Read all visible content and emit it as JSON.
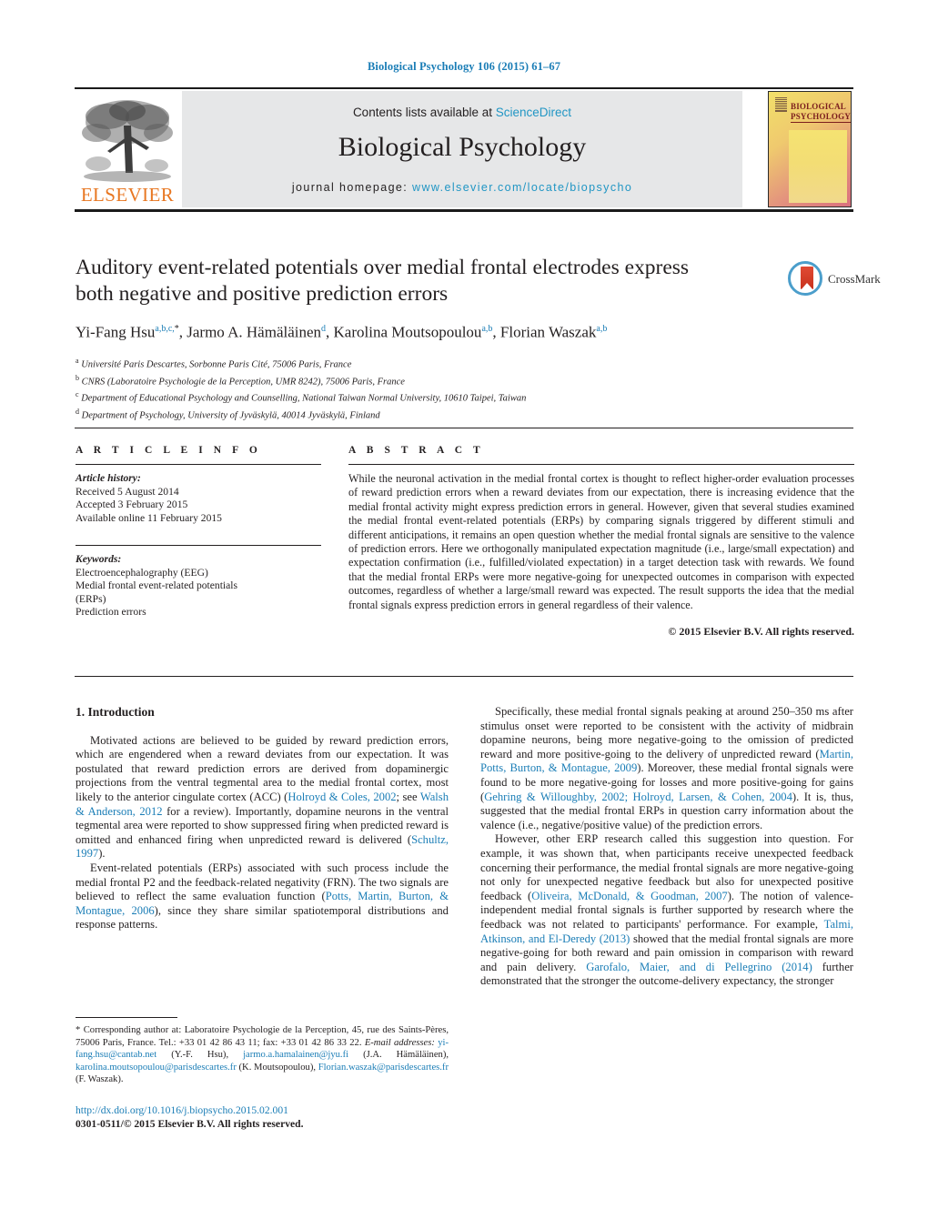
{
  "running_head": "Biological Psychology 106 (2015) 61–67",
  "masthead": {
    "contents_prefix": "Contents lists available at ",
    "sciencedirect": "ScienceDirect",
    "journal_title": "Biological Psychology",
    "homepage_prefix": "journal homepage: ",
    "homepage_url": "www.elsevier.com/locate/biopsycho",
    "publisher_logo_text": "ELSEVIER",
    "cover_title_line1": "BIOLOGICAL",
    "cover_title_line2": "PSYCHOLOGY",
    "link_color": "#2196c4",
    "header_color": "#1a7db6"
  },
  "crossmark": {
    "label": "CrossMark"
  },
  "article": {
    "title": "Auditory event-related potentials over medial frontal electrodes express both negative and positive prediction errors",
    "authors_html": "Yi-Fang Hsu<sup>a,b,c,</sup><sup class=\"star\">*</sup>, Jarmo A. Hämäläinen<sup>d</sup>, Karolina Moutsopoulou<sup>a,b</sup>, Florian Waszak<sup>a,b</sup>",
    "affiliations": [
      {
        "mark": "a",
        "text": "Université Paris Descartes, Sorbonne Paris Cité, 75006 Paris, France"
      },
      {
        "mark": "b",
        "text": "CNRS (Laboratoire Psychologie de la Perception, UMR 8242), 75006 Paris, France"
      },
      {
        "mark": "c",
        "text": "Department of Educational Psychology and Counselling, National Taiwan Normal University, 10610 Taipei, Taiwan"
      },
      {
        "mark": "d",
        "text": "Department of Psychology, University of Jyväskylä, 40014 Jyväskylä, Finland"
      }
    ]
  },
  "article_info": {
    "heading": "A R T I C L E    I N F O",
    "history_label": "Article history:",
    "history": [
      "Received 5 August 2014",
      "Accepted 3 February 2015",
      "Available online 11 February 2015"
    ],
    "keywords_label": "Keywords:",
    "keywords": [
      "Electroencephalography (EEG)",
      "Medial frontal event-related potentials",
      "(ERPs)",
      "Prediction errors"
    ]
  },
  "abstract": {
    "heading": "A B S T R A C T",
    "text": "While the neuronal activation in the medial frontal cortex is thought to reflect higher-order evaluation processes of reward prediction errors when a reward deviates from our expectation, there is increasing evidence that the medial frontal activity might express prediction errors in general. However, given that several studies examined the medial frontal event-related potentials (ERPs) by comparing signals triggered by different stimuli and different anticipations, it remains an open question whether the medial frontal signals are sensitive to the valence of prediction errors. Here we orthogonally manipulated expectation magnitude (i.e., large/small expectation) and expectation confirmation (i.e., fulfilled/violated expectation) in a target detection task with rewards. We found that the medial frontal ERPs were more negative-going for unexpected outcomes in comparison with expected outcomes, regardless of whether a large/small reward was expected. The result supports the idea that the medial frontal signals express prediction errors in general regardless of their valence.",
    "copyright": "© 2015 Elsevier B.V. All rights reserved."
  },
  "body": {
    "section_heading": "1.  Introduction",
    "left_paragraph_1": "Motivated actions are believed to be guided by reward prediction errors, which are engendered when a reward deviates from our expectation. It was postulated that reward prediction errors are derived from dopaminergic projections from the ventral tegmental area to the medial frontal cortex, most likely to the anterior cingulate cortex (ACC) (",
    "left_p1_ref1": "Holroyd & Coles, 2002",
    "left_p1_mid1": "; see ",
    "left_p1_ref2": "Walsh & Anderson, 2012",
    "left_p1_mid2": " for a review). Importantly, dopamine neurons in the ventral tegmental area were reported to show suppressed firing when predicted reward is omitted and enhanced firing when unpredicted reward is delivered (",
    "left_p1_ref3": "Schultz, 1997",
    "left_p1_end": ").",
    "left_paragraph_2": "Event-related potentials (ERPs) associated with such process include the medial frontal P2 and the feedback-related negativity (FRN). The two signals are believed to reflect the same evaluation function (",
    "left_p2_ref1": "Potts, Martin, Burton, & Montague, 2006",
    "left_p2_end": "), since they share similar spatiotemporal distributions and response patterns.",
    "right_paragraph_1": "Specifically, these medial frontal signals peaking at around 250–350 ms after stimulus onset were reported to be consistent with the activity of midbrain dopamine neurons, being more negative-going to the omission of predicted reward and more positive-going to the delivery of unpredicted reward (",
    "right_p1_ref1": "Martin, Potts, Burton, & Montague, 2009",
    "right_p1_mid1": "). Moreover, these medial frontal signals were found to be more negative-going for losses and more positive-going for gains (",
    "right_p1_ref2": "Gehring & Willoughby, 2002; Holroyd, Larsen, & Cohen, 2004",
    "right_p1_end": "). It is, thus, suggested that the medial frontal ERPs in question carry information about the valence (i.e., negative/positive value) of the prediction errors.",
    "right_paragraph_2": "However, other ERP research called this suggestion into question. For example, it was shown that, when participants receive unexpected feedback concerning their performance, the medial frontal signals are more negative-going not only for unexpected negative feedback but also for unexpected positive feedback (",
    "right_p2_ref1": "Oliveira, McDonald, & Goodman, 2007",
    "right_p2_mid1": "). The notion of valence-independent medial frontal signals is further supported by research where the feedback was not related to participants' performance. For example, ",
    "right_p2_ref2": "Talmi, Atkinson, and El-Deredy (2013)",
    "right_p2_mid2": " showed that the medial frontal signals are more negative-going for both reward and pain omission in comparison with reward and pain delivery. ",
    "right_p2_ref3": "Garofalo, Maier, and di Pellegrino (2014)",
    "right_p2_end": " further demonstrated that the stronger the outcome-delivery expectancy, the stronger"
  },
  "footnote": {
    "corresponding": "*  Corresponding author at: Laboratoire Psychologie de la Perception, 45, rue des Saints-Pères, 75006 Paris, France. Tel.: +33 01 42 86 43 11; fax: +33 01 42 86 33 22.",
    "email_label": "E-mail addresses:",
    "emails": [
      {
        "address": "yi-fang.hsu@cantab.net",
        "owner": "(Y.-F. Hsu)"
      },
      {
        "address": "jarmo.a.hamalainen@jyu.fi",
        "owner": "(J.A. Hämäläinen)"
      },
      {
        "address": "karolina.moutsopoulou@parisdescartes.fr",
        "owner": "(K. Moutsopoulou)"
      },
      {
        "address": "Florian.waszak@parisdescartes.fr",
        "owner": "(F. Waszak)"
      }
    ],
    "doi_url": "http://dx.doi.org/10.1016/j.biopsycho.2015.02.001",
    "issn_copyright": "0301-0511/© 2015 Elsevier B.V. All rights reserved."
  }
}
